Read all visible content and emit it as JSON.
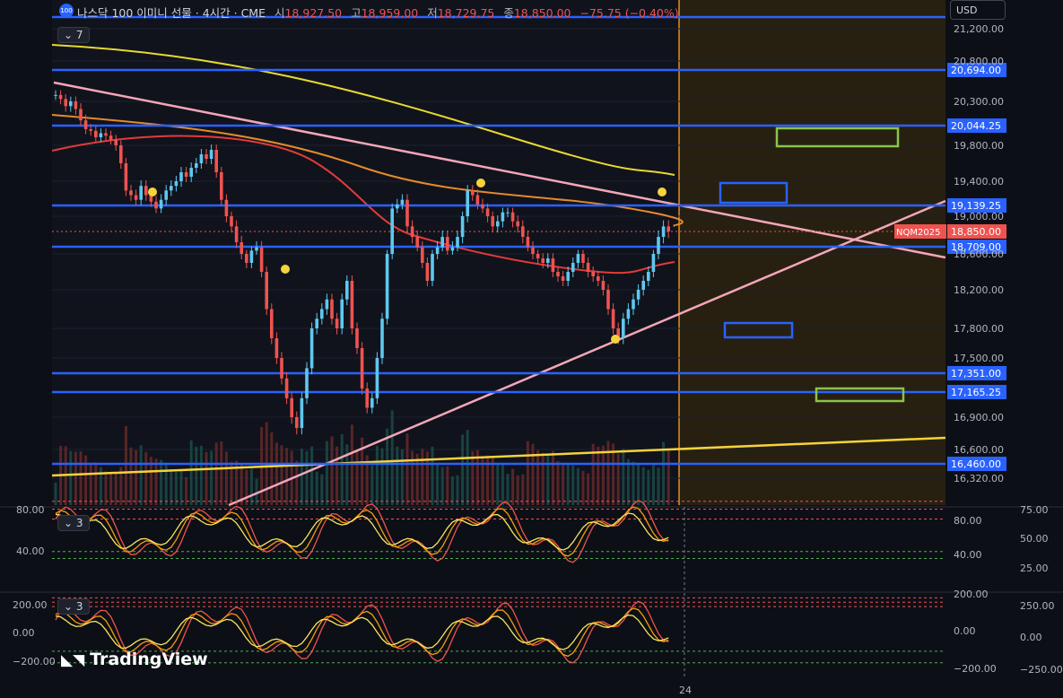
{
  "header": {
    "badge": "100",
    "symbol": "나스닥 100 이미니 선물 · 4시간 · CME",
    "open_label": "시",
    "open": "18,927.50",
    "high_label": "고",
    "high": "18,959.00",
    "low_label": "저",
    "low": "18,729.75",
    "close_label": "종",
    "close": "18,850.00",
    "change": "−75.75 (−0.40%)"
  },
  "currency": "USD",
  "indicator_toggle": "7",
  "osc1_toggle": "3",
  "osc2_toggle": "3",
  "brand": "TradingView",
  "time_label": "24",
  "colors": {
    "bg": "#0d0f16",
    "up": "#26a69a",
    "down": "#ef5350",
    "hline": "#2962ff",
    "zone": "#2a2211"
  },
  "chart_data": [
    {
      "type": "line",
      "title": "",
      "price_axis_ticks": [
        "21,200.00",
        "20,800.00",
        "20,300.00",
        "19,800.00",
        "19,400.00",
        "19,000.00",
        "18,600.00",
        "18,200.00",
        "17,800.00",
        "17,500.00",
        "16,900.00",
        "16,600.00",
        "16,320.00"
      ],
      "horizontal_levels": [
        "20,694.00",
        "20,044.25",
        "19,139.25",
        "18,709.00",
        "17,351.00",
        "17,165.25",
        "16,460.00"
      ],
      "current_price": "18,850.00",
      "current_price_symbol": "NQM2025",
      "ylim": [
        16200,
        21300
      ],
      "close_path": [
        20380,
        20330,
        20250,
        20300,
        20220,
        20100,
        20000,
        19980,
        19900,
        19950,
        19920,
        19870,
        19800,
        19600,
        19300,
        19250,
        19200,
        19350,
        19250,
        19180,
        19100,
        19200,
        19300,
        19350,
        19400,
        19500,
        19450,
        19550,
        19600,
        19700,
        19650,
        19750,
        19500,
        19200,
        19000,
        18900,
        18750,
        18600,
        18500,
        18650,
        18700,
        18400,
        18000,
        17700,
        17500,
        17300,
        17100,
        16900,
        16800,
        17100,
        17400,
        17800,
        17900,
        18000,
        18100,
        17900,
        17800,
        18100,
        18300,
        17800,
        17600,
        17200,
        17000,
        17100,
        17500,
        17900,
        18600,
        19100,
        19150,
        19200,
        18900,
        18800,
        18700,
        18500,
        18300,
        18600,
        18700,
        18800,
        18650,
        18700,
        18800,
        19000,
        19300,
        19250,
        19150,
        19100,
        19000,
        18900,
        18950,
        19050,
        19050,
        18950,
        18900,
        18800,
        18700,
        18600,
        18550,
        18500,
        18550,
        18400,
        18350,
        18300,
        18400,
        18500,
        18600,
        18500,
        18400,
        18350,
        18300,
        18200,
        18000,
        17800,
        17700,
        17900,
        18000,
        18100,
        18200,
        18300,
        18400,
        18600,
        18800,
        18900,
        18850
      ]
    },
    {
      "type": "line",
      "title": "",
      "price_axis_ticks": [
        "80.00",
        "40.00"
      ],
      "right_axis_ticks": [
        "75.00",
        "50.00",
        "25.00"
      ],
      "ylim": [
        0,
        100
      ]
    },
    {
      "type": "line",
      "title": "",
      "price_axis_ticks": [
        "200.00",
        "0.00",
        "−200.00"
      ],
      "right_axis_ticks": [
        "250.00",
        "0.00",
        "−250.00"
      ],
      "ylim": [
        -280,
        280
      ]
    }
  ]
}
